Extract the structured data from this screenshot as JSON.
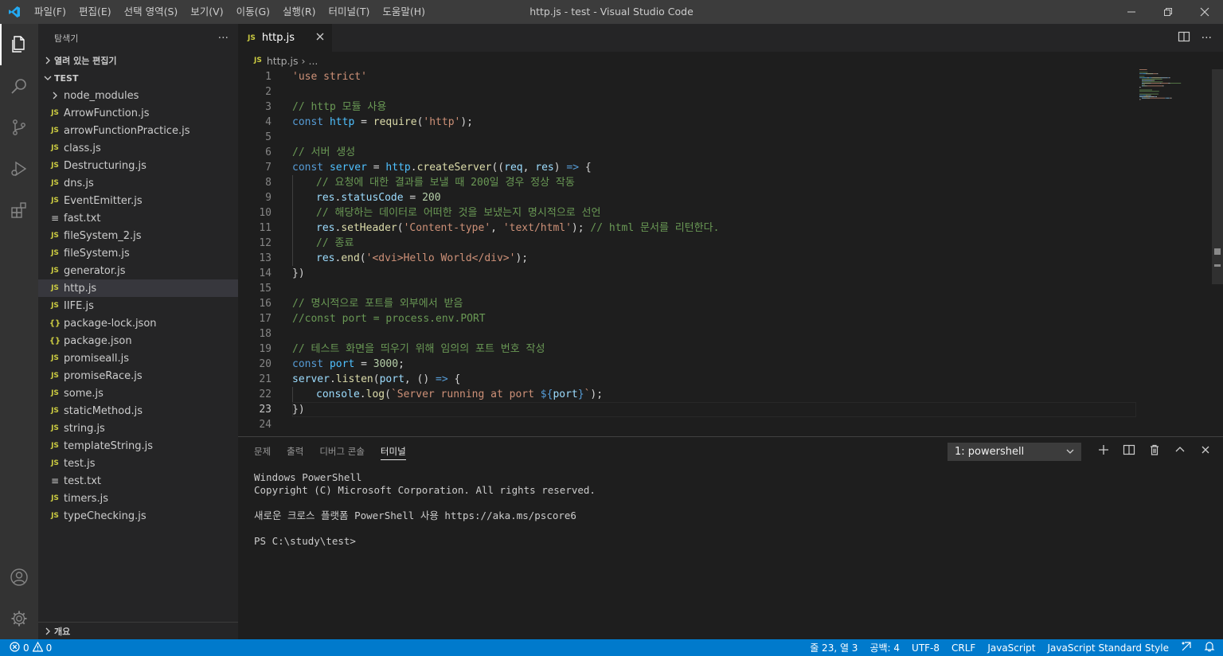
{
  "titlebar": {
    "menu": [
      "파일(F)",
      "편집(E)",
      "선택 영역(S)",
      "보기(V)",
      "이동(G)",
      "실행(R)",
      "터미널(T)",
      "도움말(H)"
    ],
    "window_title": "http.js - test - Visual Studio Code"
  },
  "sidebar": {
    "header": "탐색기",
    "more": "···",
    "open_editors": "열려 있는 편집기",
    "folder": "TEST",
    "files": [
      {
        "name": "node_modules",
        "type": "folder"
      },
      {
        "name": "ArrowFunction.js",
        "type": "js"
      },
      {
        "name": "arrowFunctionPractice.js",
        "type": "js"
      },
      {
        "name": "class.js",
        "type": "js"
      },
      {
        "name": "Destructuring.js",
        "type": "js"
      },
      {
        "name": "dns.js",
        "type": "js"
      },
      {
        "name": "EventEmitter.js",
        "type": "js"
      },
      {
        "name": "fast.txt",
        "type": "txt"
      },
      {
        "name": "fileSystem_2.js",
        "type": "js"
      },
      {
        "name": "fileSystem.js",
        "type": "js"
      },
      {
        "name": "generator.js",
        "type": "js"
      },
      {
        "name": "http.js",
        "type": "js"
      },
      {
        "name": "IIFE.js",
        "type": "js"
      },
      {
        "name": "package-lock.json",
        "type": "json"
      },
      {
        "name": "package.json",
        "type": "json"
      },
      {
        "name": "promiseall.js",
        "type": "js"
      },
      {
        "name": "promiseRace.js",
        "type": "js"
      },
      {
        "name": "some.js",
        "type": "js"
      },
      {
        "name": "staticMethod.js",
        "type": "js"
      },
      {
        "name": "string.js",
        "type": "js"
      },
      {
        "name": "templateString.js",
        "type": "js"
      },
      {
        "name": "test.js",
        "type": "js"
      },
      {
        "name": "test.txt",
        "type": "txt"
      },
      {
        "name": "timers.js",
        "type": "js"
      },
      {
        "name": "typeChecking.js",
        "type": "js"
      }
    ],
    "selected_file": "http.js",
    "outline": "개요"
  },
  "editor": {
    "tab_label": "http.js",
    "tab_badge": "JS",
    "breadcrumb_file": "http.js",
    "breadcrumb_rest": "...",
    "current_line": 23,
    "lines": [
      [
        [
          "'use strict'",
          "s"
        ]
      ],
      [],
      [
        [
          "// http 모듈 사용",
          "c"
        ]
      ],
      [
        [
          "const ",
          "k"
        ],
        [
          "http",
          "r"
        ],
        [
          " = ",
          "p"
        ],
        [
          "require",
          "f"
        ],
        [
          "(",
          "p"
        ],
        [
          "'http'",
          "s"
        ],
        [
          ");",
          "p"
        ]
      ],
      [],
      [
        [
          "// 서버 생성",
          "c"
        ]
      ],
      [
        [
          "const ",
          "k"
        ],
        [
          "server",
          "r"
        ],
        [
          " = ",
          "p"
        ],
        [
          "http",
          "r"
        ],
        [
          ".",
          "p"
        ],
        [
          "createServer",
          "f"
        ],
        [
          "((",
          "p"
        ],
        [
          "req",
          "v"
        ],
        [
          ", ",
          "p"
        ],
        [
          "res",
          "v"
        ],
        [
          ") ",
          "p"
        ],
        [
          "=>",
          "k"
        ],
        [
          " {",
          "p"
        ]
      ],
      [
        [
          "@1",
          ""
        ],
        [
          "// 요청에 대한 결과를 보낼 때 200일 경우 정상 작동",
          "c"
        ]
      ],
      [
        [
          "@1",
          ""
        ],
        [
          "res",
          "v"
        ],
        [
          ".",
          "p"
        ],
        [
          "statusCode",
          "v"
        ],
        [
          " = ",
          "p"
        ],
        [
          "200",
          "n"
        ]
      ],
      [
        [
          "@1",
          ""
        ],
        [
          "// 해당하는 데이터로 어떠한 것을 보냈는지 명시적으로 선언",
          "c"
        ]
      ],
      [
        [
          "@1",
          ""
        ],
        [
          "res",
          "v"
        ],
        [
          ".",
          "p"
        ],
        [
          "setHeader",
          "f"
        ],
        [
          "(",
          "p"
        ],
        [
          "'Content-type'",
          "s"
        ],
        [
          ", ",
          "p"
        ],
        [
          "'text/html'",
          "s"
        ],
        [
          "); ",
          "p"
        ],
        [
          "// html 문서를 리턴한다.",
          "c"
        ]
      ],
      [
        [
          "@1",
          ""
        ],
        [
          "// 종료",
          "c"
        ]
      ],
      [
        [
          "@1",
          ""
        ],
        [
          "res",
          "v"
        ],
        [
          ".",
          "p"
        ],
        [
          "end",
          "f"
        ],
        [
          "(",
          "p"
        ],
        [
          "'<dvi>Hello World</div>'",
          "s"
        ],
        [
          ");",
          "p"
        ]
      ],
      [
        [
          "})",
          "p"
        ]
      ],
      [],
      [
        [
          "// 명시적으로 포트를 외부에서 받음",
          "c"
        ]
      ],
      [
        [
          "//const port = process.env.PORT",
          "c"
        ]
      ],
      [],
      [
        [
          "// 테스트 화면을 띄우기 위해 임의의 포트 번호 작성",
          "c"
        ]
      ],
      [
        [
          "const ",
          "k"
        ],
        [
          "port",
          "r"
        ],
        [
          " = ",
          "p"
        ],
        [
          "3000",
          "n"
        ],
        [
          ";",
          "p"
        ]
      ],
      [
        [
          "server",
          "v"
        ],
        [
          ".",
          "p"
        ],
        [
          "listen",
          "f"
        ],
        [
          "(",
          "p"
        ],
        [
          "port",
          "v"
        ],
        [
          ", () ",
          "p"
        ],
        [
          "=>",
          "k"
        ],
        [
          " {",
          "p"
        ]
      ],
      [
        [
          "@1",
          ""
        ],
        [
          "console",
          "v"
        ],
        [
          ".",
          "p"
        ],
        [
          "log",
          "f"
        ],
        [
          "(",
          "p"
        ],
        [
          "`Server running at port ",
          "s"
        ],
        [
          "${",
          "k"
        ],
        [
          "port",
          "v"
        ],
        [
          "}",
          "k"
        ],
        [
          "`",
          "s"
        ],
        [
          ");",
          "p"
        ]
      ],
      [
        [
          "})",
          "p"
        ]
      ],
      []
    ]
  },
  "panel": {
    "tabs": [
      "문제",
      "출력",
      "디버그 콘솔",
      "터미널"
    ],
    "active_tab": "터미널",
    "terminal_select": "1: powershell",
    "terminal_lines": [
      "Windows PowerShell",
      "Copyright (C) Microsoft Corporation. All rights reserved.",
      "",
      "새로운 크로스 플랫폼 PowerShell 사용 https://aka.ms/pscore6",
      "",
      "PS C:\\study\\test>"
    ]
  },
  "statusbar": {
    "errors": "0",
    "warnings": "0",
    "position": "줄 23, 열 3",
    "spaces": "공백: 4",
    "encoding": "UTF-8",
    "eol": "CRLF",
    "language": "JavaScript",
    "formatter": "JavaScript Standard Style"
  },
  "colors": {
    "accent": "#007acc",
    "activity_bar": "#333333",
    "sidebar": "#252526",
    "editor": "#1e1e1e",
    "js_icon": "#cbcb41"
  }
}
